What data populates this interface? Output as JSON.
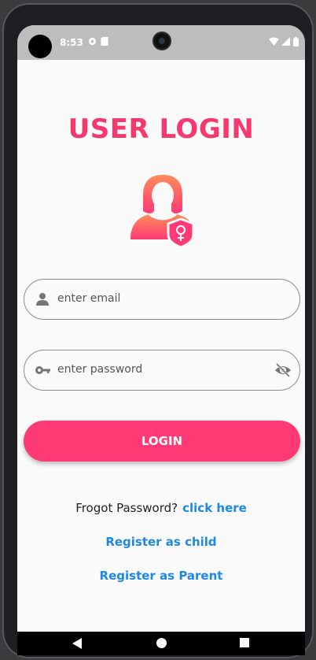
{
  "status_bar": {
    "time": "8:53"
  },
  "screen": {
    "title": "USER LOGIN"
  },
  "form": {
    "email_placeholder": "enter email",
    "password_placeholder": "enter password",
    "login_label": "LOGIN"
  },
  "links": {
    "forgot_text": "Frogot Password?",
    "forgot_link": "click here",
    "register_child": "Register as child",
    "register_parent": "Register as Parent"
  },
  "icons": {
    "avatar": "female-user-shield-icon",
    "email": "person-icon",
    "password": "key-icon",
    "visibility": "eye-off-icon"
  },
  "colors": {
    "accent": "#ff3a74",
    "title": "#f5396e",
    "link": "#1e88e5"
  }
}
